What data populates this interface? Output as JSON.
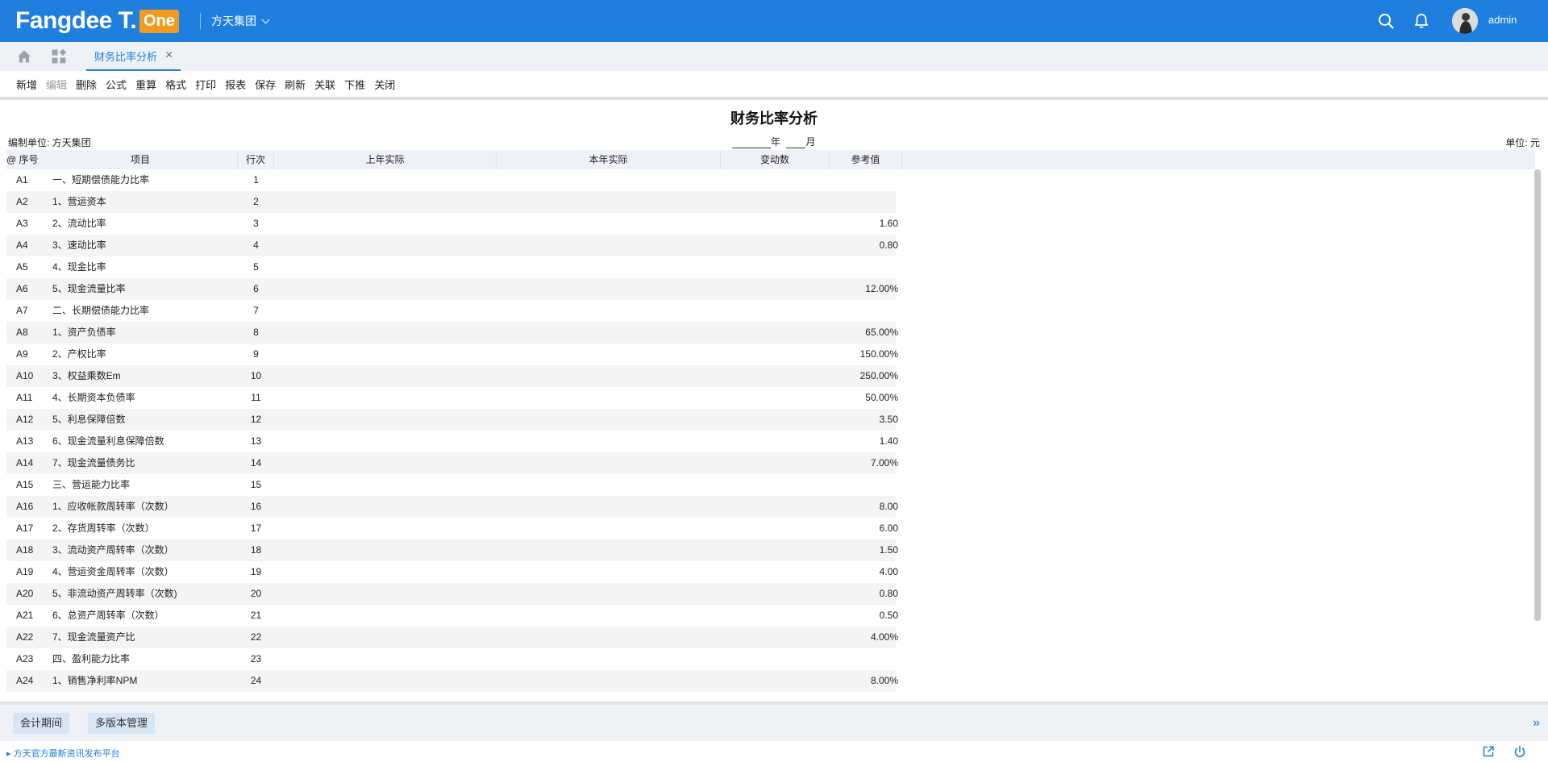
{
  "header": {
    "logo_text": "Fangdee T.",
    "logo_badge": "One",
    "org_name": "方天集团",
    "user_name": "admin"
  },
  "tabs": {
    "active_label": "财务比率分析",
    "close_glyph": "×"
  },
  "toolbar": {
    "buttons": [
      {
        "label": "新增",
        "enabled": true
      },
      {
        "label": "编辑",
        "enabled": false
      },
      {
        "label": "删除",
        "enabled": true
      },
      {
        "label": "公式",
        "enabled": true
      },
      {
        "label": "重算",
        "enabled": true
      },
      {
        "label": "格式",
        "enabled": true
      },
      {
        "label": "打印",
        "enabled": true
      },
      {
        "label": "报表",
        "enabled": true
      },
      {
        "label": "保存",
        "enabled": true
      },
      {
        "label": "刷新",
        "enabled": true
      },
      {
        "label": "关联",
        "enabled": true
      },
      {
        "label": "下推",
        "enabled": true
      },
      {
        "label": "关闭",
        "enabled": true
      }
    ]
  },
  "report": {
    "title": "财务比率分析",
    "org_label": "编制单位: 方天集团",
    "year_suffix": "年",
    "month_suffix": "月",
    "unit_label": "单位: 元",
    "columns": {
      "marker": "@",
      "seq": "序号",
      "item": "项目",
      "line": "行次",
      "prev_year": "上年实际",
      "this_year": "本年实际",
      "change": "变动数",
      "reference": "参考值"
    },
    "rows": [
      {
        "seq": "A1",
        "item": "一、短期偿债能力比率",
        "line": "1",
        "ref": ""
      },
      {
        "seq": "A2",
        "item": "1、营运资本",
        "line": "2",
        "ref": ""
      },
      {
        "seq": "A3",
        "item": "2、流动比率",
        "line": "3",
        "ref": "1.60"
      },
      {
        "seq": "A4",
        "item": "3、速动比率",
        "line": "4",
        "ref": "0.80"
      },
      {
        "seq": "A5",
        "item": "4、现金比率",
        "line": "5",
        "ref": ""
      },
      {
        "seq": "A6",
        "item": "5、现金流量比率",
        "line": "6",
        "ref": "12.00%"
      },
      {
        "seq": "A7",
        "item": "二、长期偿债能力比率",
        "line": "7",
        "ref": ""
      },
      {
        "seq": "A8",
        "item": "1、资产负债率",
        "line": "8",
        "ref": "65.00%"
      },
      {
        "seq": "A9",
        "item": "2、产权比率",
        "line": "9",
        "ref": "150.00%"
      },
      {
        "seq": "A10",
        "item": "3、权益乘数Em",
        "line": "10",
        "ref": "250.00%"
      },
      {
        "seq": "A11",
        "item": "4、长期资本负债率",
        "line": "11",
        "ref": "50.00%"
      },
      {
        "seq": "A12",
        "item": "5、利息保障倍数",
        "line": "12",
        "ref": "3.50"
      },
      {
        "seq": "A13",
        "item": "6、现金流量利息保障倍数",
        "line": "13",
        "ref": "1.40"
      },
      {
        "seq": "A14",
        "item": "7、现金流量债务比",
        "line": "14",
        "ref": "7.00%"
      },
      {
        "seq": "A15",
        "item": "三、营运能力比率",
        "line": "15",
        "ref": ""
      },
      {
        "seq": "A16",
        "item": "1、应收帐款周转率（次数）",
        "line": "16",
        "ref": "8.00"
      },
      {
        "seq": "A17",
        "item": "2、存货周转率（次数）",
        "line": "17",
        "ref": "6.00"
      },
      {
        "seq": "A18",
        "item": "3、流动资产周转率（次数）",
        "line": "18",
        "ref": "1.50"
      },
      {
        "seq": "A19",
        "item": "4、营运资金周转率（次数）",
        "line": "19",
        "ref": "4.00"
      },
      {
        "seq": "A20",
        "item": "5、非流动资产周转率（次数)",
        "line": "20",
        "ref": "0.80"
      },
      {
        "seq": "A21",
        "item": "6、总资产周转率（次数）",
        "line": "21",
        "ref": "0.50"
      },
      {
        "seq": "A22",
        "item": "7、现金流量资产比",
        "line": "22",
        "ref": "4.00%"
      },
      {
        "seq": "A23",
        "item": "四、盈利能力比率",
        "line": "23",
        "ref": ""
      },
      {
        "seq": "A24",
        "item": "1、销售净利率NPM",
        "line": "24",
        "ref": "8.00%"
      }
    ]
  },
  "bottom": {
    "btn_period": "会计期间",
    "btn_versions": "多版本管理",
    "expand_glyph": "»",
    "news_link": "方天官方最新资讯发布平台"
  },
  "colors": {
    "brand_blue": "#1e7fde",
    "logo_orange": "#f39a1e"
  }
}
